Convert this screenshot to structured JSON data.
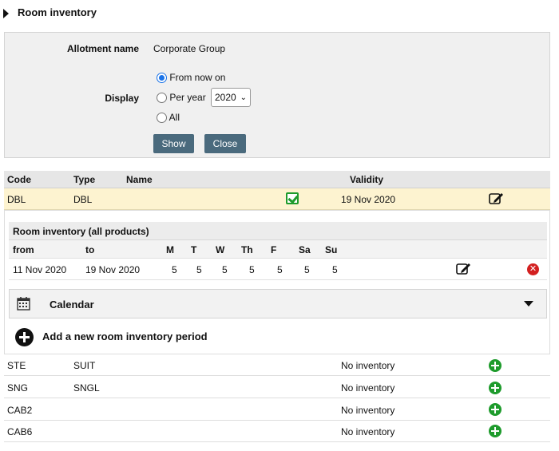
{
  "header": {
    "title": "Room inventory"
  },
  "filter": {
    "allotment_label": "Allotment name",
    "allotment_value": "Corporate Group",
    "display_label": "Display",
    "options": [
      "From now on",
      "Per year",
      "All"
    ],
    "selected_option": "From now on",
    "year": "2020",
    "show_label": "Show",
    "close_label": "Close"
  },
  "table": {
    "headers": {
      "code": "Code",
      "type": "Type",
      "name": "Name",
      "validity": "Validity"
    },
    "selected_row": {
      "code": "DBL",
      "type": "DBL",
      "validity": "19 Nov 2020"
    },
    "rows": [
      {
        "code": "STE",
        "type": "SUIT",
        "validity": "No inventory"
      },
      {
        "code": "SNG",
        "type": "SNGL",
        "validity": "No inventory"
      },
      {
        "code": "CAB2",
        "type": "",
        "validity": "No inventory"
      },
      {
        "code": "CAB6",
        "type": "",
        "validity": "No inventory"
      }
    ]
  },
  "inventory": {
    "title": "Room inventory (all products)",
    "headers": {
      "from": "from",
      "to": "to",
      "days": [
        "M",
        "T",
        "W",
        "Th",
        "F",
        "Sa",
        "Su"
      ]
    },
    "row": {
      "from": "11 Nov 2020",
      "to": "19 Nov 2020",
      "days": [
        "5",
        "5",
        "5",
        "5",
        "5",
        "5",
        "5"
      ]
    },
    "calendar_label": "Calendar",
    "add_label": "Add a new room inventory period"
  },
  "colors": {
    "accent_button": "#4a6a7d",
    "selected_row": "#fdf3d0",
    "add_green": "#1e9b2c",
    "delete_red": "#d32020"
  }
}
